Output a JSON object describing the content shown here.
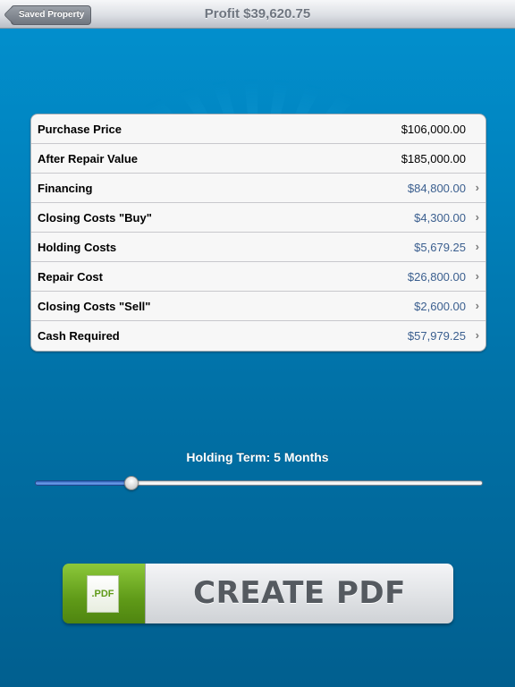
{
  "navbar": {
    "back_label": "Saved Property",
    "title": "Profit $39,620.75"
  },
  "table": {
    "rows": [
      {
        "label": "Purchase Price",
        "value": "$106,000.00",
        "link": false
      },
      {
        "label": "After Repair Value",
        "value": "$185,000.00",
        "link": false
      },
      {
        "label": "Financing",
        "value": "$84,800.00",
        "link": true
      },
      {
        "label": "Closing Costs \"Buy\"",
        "value": "$4,300.00",
        "link": true
      },
      {
        "label": "Holding Costs",
        "value": "$5,679.25",
        "link": true
      },
      {
        "label": "Repair Cost",
        "value": "$26,800.00",
        "link": true
      },
      {
        "label": "Closing Costs \"Sell\"",
        "value": "$2,600.00",
        "link": true
      },
      {
        "label": "Cash Required",
        "value": "$57,979.25",
        "link": true
      }
    ],
    "chevron_icon": "chevron-right-icon",
    "chevron_glyph": "›"
  },
  "slider": {
    "label": "Holding Term: 5 Months",
    "value_fraction": 0.216
  },
  "pdf_button": {
    "icon_text": ".PDF",
    "label": "CREATE PDF"
  },
  "colors": {
    "link_value": "#3b5f8f",
    "pdf_green": "#6aa81e"
  }
}
